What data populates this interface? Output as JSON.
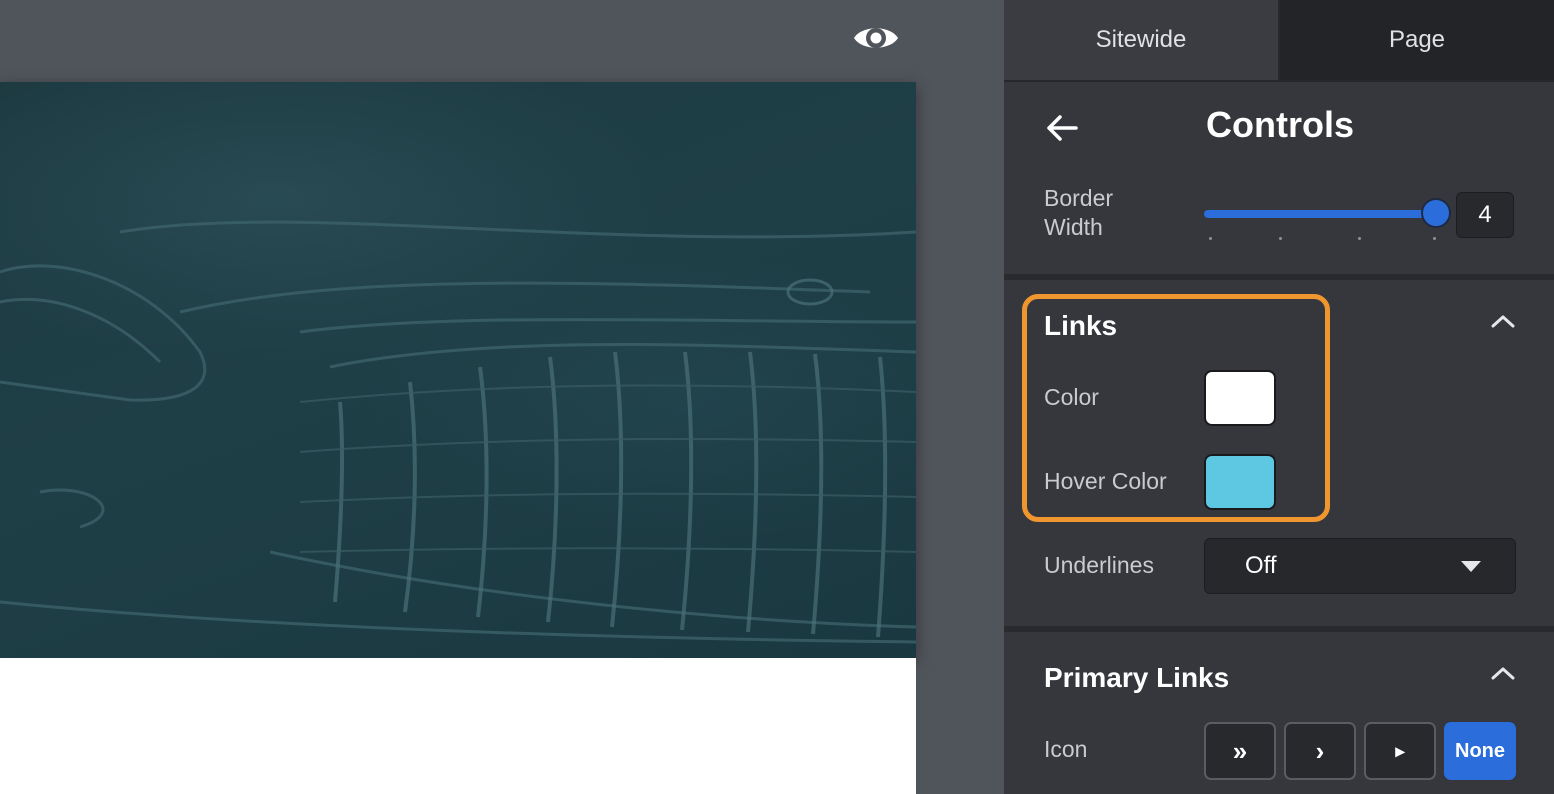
{
  "panel": {
    "tabs": [
      {
        "label": "Sitewide"
      },
      {
        "label": "Page"
      }
    ],
    "title": "Controls",
    "border_width": {
      "label_line1": "Border",
      "label_line2": "Width",
      "value": "4",
      "slider_fraction": 1.0
    },
    "links": {
      "title": "Links",
      "color_label": "Color",
      "color_value": "#ffffff",
      "hover_label": "Hover Color",
      "hover_value": "#5ec8e3",
      "underlines_label": "Underlines",
      "underlines_value": "Off"
    },
    "primary_links": {
      "title": "Primary Links",
      "icon_label": "Icon",
      "icon_options": [
        "»",
        "›",
        "▸",
        "None"
      ],
      "icon_selected": "None"
    }
  },
  "colors": {
    "accent": "#2a6ddb",
    "highlight": "#f0962f"
  }
}
